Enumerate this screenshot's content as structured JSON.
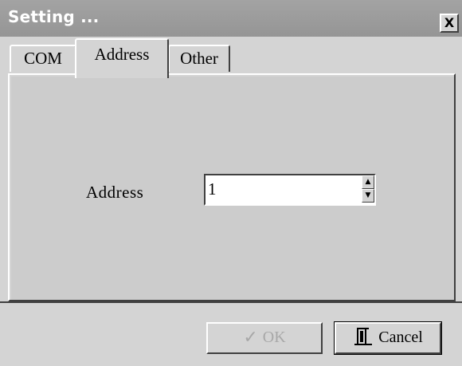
{
  "window": {
    "title": "Setting ...",
    "close_glyph": "X"
  },
  "tabs": [
    {
      "label": "COM",
      "selected": false
    },
    {
      "label": "Address",
      "selected": true
    },
    {
      "label": "Other",
      "selected": false
    }
  ],
  "address_page": {
    "label": "Address",
    "value": "1",
    "spin_up_glyph": "▲",
    "spin_down_glyph": "▼"
  },
  "buttons": {
    "ok": {
      "label": "OK",
      "enabled": false,
      "icon": "checkmark-icon",
      "icon_glyph": "✓"
    },
    "cancel": {
      "label": "Cancel",
      "enabled": true,
      "icon": "door-exit-icon",
      "icon_glyph": "Ⓡ"
    }
  },
  "colors": {
    "titlebar": "#959595",
    "face": "#d4d4d4",
    "disabled_text": "#a8a8a8"
  }
}
